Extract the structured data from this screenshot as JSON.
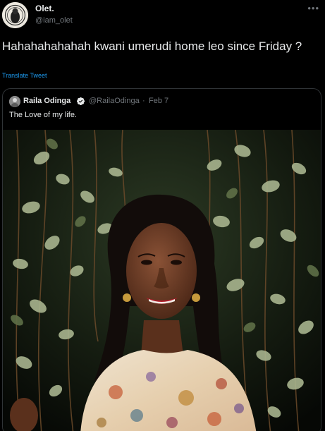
{
  "author": {
    "display_name": "Olet.",
    "handle": "@iam_olet",
    "more_icon": "ellipsis-icon"
  },
  "tweet": {
    "text": "Hahahahahahah kwani umerudi home leo since Friday ?",
    "translate_label": "Translate Tweet"
  },
  "quoted": {
    "display_name": "Raila Odinga",
    "verified_icon": "verified-badge-icon",
    "handle": "@RailaOdinga",
    "separator": "·",
    "date": "Feb 7",
    "text": "The Love of my life."
  },
  "colors": {
    "background": "#000000",
    "primary_text": "#e7e9ea",
    "secondary_text": "#71767b",
    "link": "#1d9bf0",
    "border": "#2f3336"
  }
}
